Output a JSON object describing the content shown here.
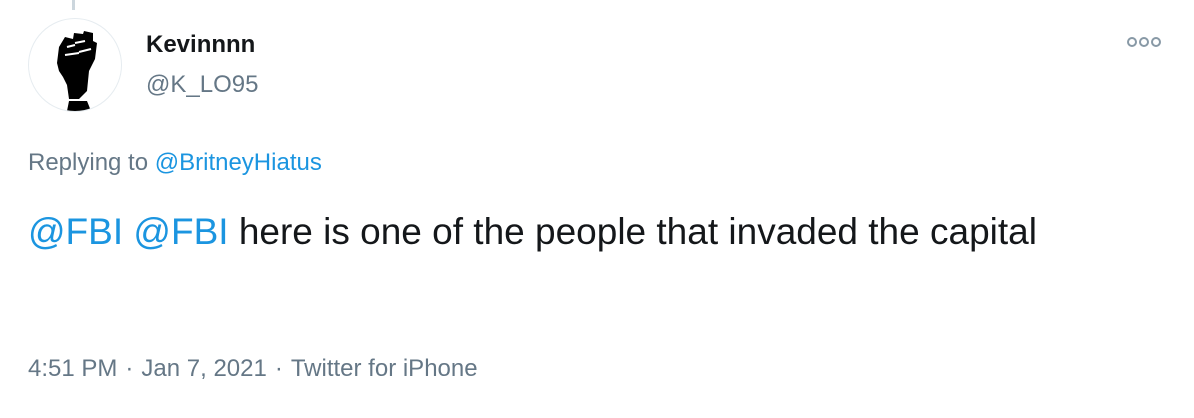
{
  "author": {
    "display_name": "Kevinnnn",
    "handle": "@K_LO95",
    "avatar_icon": "raised-fist-icon"
  },
  "more_icon": "more-options-icon",
  "reply": {
    "prefix": "Replying to ",
    "to_handle": "@BritneyHiatus"
  },
  "tweet": {
    "mention_1": "@FBI",
    "mention_2": "@FBI",
    "body": "here is one of the people that invaded the capital"
  },
  "meta": {
    "time": "4:51 PM",
    "separator": "·",
    "date": "Jan 7, 2021",
    "source": "Twitter for iPhone"
  },
  "colors": {
    "link": "#1b95e0",
    "secondary_text": "#657786",
    "primary_text": "#14171a"
  }
}
